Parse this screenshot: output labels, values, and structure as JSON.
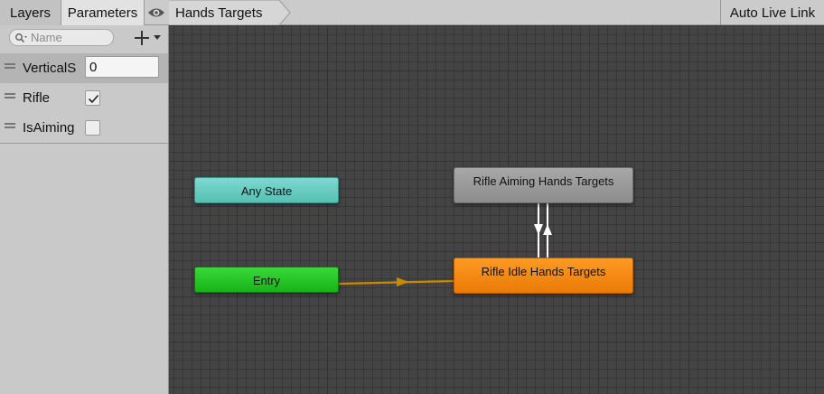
{
  "toolbar": {
    "tabs": [
      {
        "label": "Layers"
      },
      {
        "label": "Parameters"
      }
    ],
    "visibility_icon": "eye-icon",
    "breadcrumb": "Hands Targets",
    "live_link_label": "Auto Live Link"
  },
  "parameters": {
    "search_placeholder": "Name",
    "search_icon": "search-icon",
    "add_icon": "plus-dropdown-icon",
    "items": [
      {
        "name": "VerticalS",
        "type": "float",
        "value": "0"
      },
      {
        "name": "Rifle",
        "type": "bool",
        "checked": true
      },
      {
        "name": "IsAiming",
        "type": "bool",
        "checked": false
      }
    ]
  },
  "graph": {
    "nodes": {
      "any_state": "Any State",
      "entry": "Entry",
      "rifle_aiming": "Rifle Aiming Hands Targets",
      "rifle_idle": "Rifle Idle Hands Targets"
    },
    "colors": {
      "any_state": "#6ccdc3",
      "entry": "#22c322",
      "default_state": "#e98a12",
      "state": "#9a9a9a",
      "entry_transition": "#c98800",
      "transition": "#ffffff"
    }
  }
}
